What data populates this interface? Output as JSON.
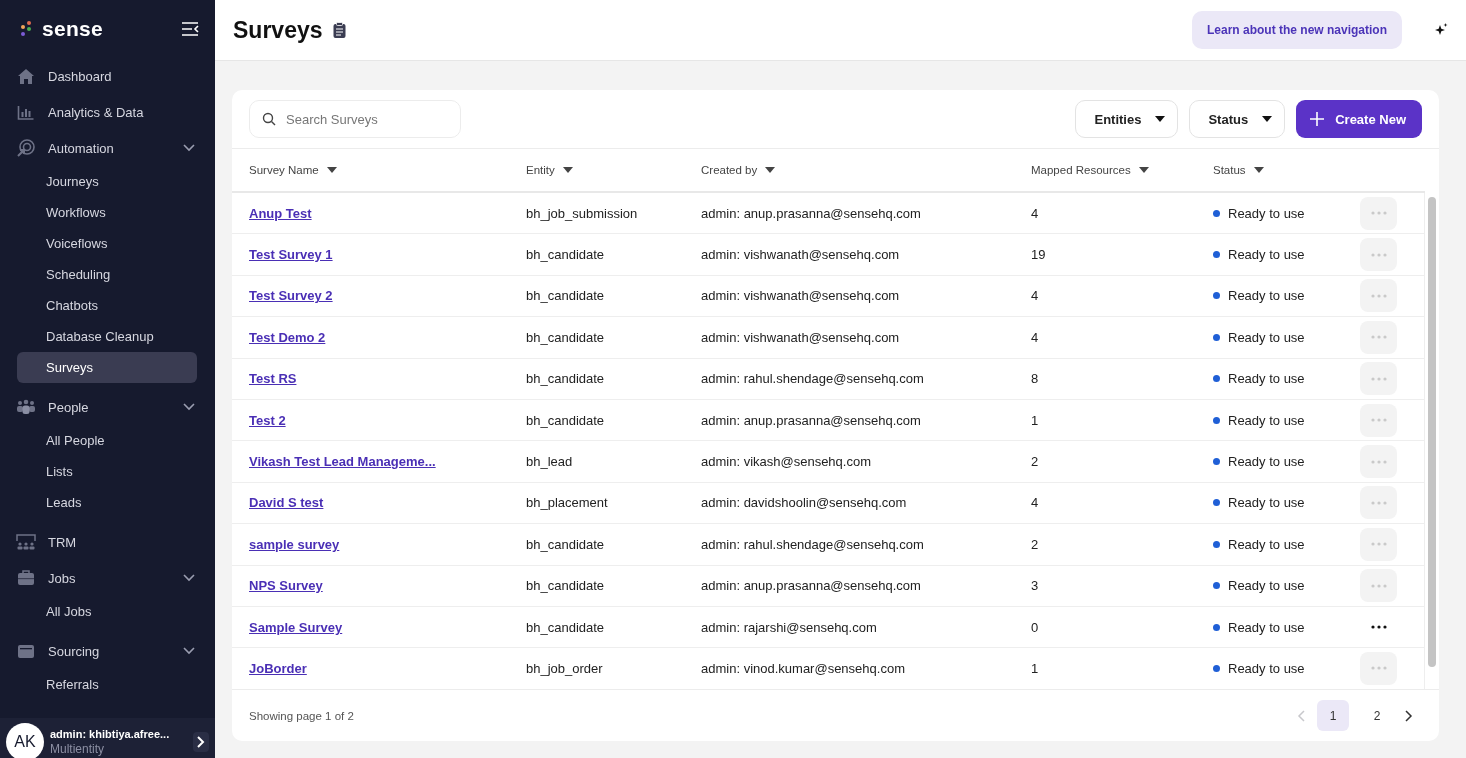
{
  "sidebar": {
    "logo": "sense",
    "nav": [
      {
        "label": "Dashboard"
      },
      {
        "label": "Analytics & Data"
      },
      {
        "label": "Automation",
        "expanded": true,
        "children": [
          {
            "label": "Journeys",
            "selected": false
          },
          {
            "label": "Workflows",
            "selected": false
          },
          {
            "label": "Voiceflows",
            "selected": false
          },
          {
            "label": "Scheduling",
            "selected": false
          },
          {
            "label": "Chatbots",
            "selected": false
          },
          {
            "label": "Database Cleanup",
            "selected": false
          },
          {
            "label": "Surveys",
            "selected": true
          }
        ]
      },
      {
        "label": "People",
        "expanded": true,
        "children": [
          {
            "label": "All People",
            "selected": false
          },
          {
            "label": "Lists",
            "selected": false
          },
          {
            "label": "Leads",
            "selected": false
          }
        ]
      },
      {
        "label": "TRM"
      },
      {
        "label": "Jobs",
        "expanded": true,
        "children": [
          {
            "label": "All Jobs",
            "selected": false
          }
        ]
      },
      {
        "label": "Sourcing",
        "expanded": true,
        "children": [
          {
            "label": "Referrals",
            "selected": false
          }
        ]
      }
    ],
    "user": {
      "initials": "AK",
      "name": "admin: khibtiya.afree...",
      "subtitle": "Multientity"
    }
  },
  "header": {
    "title": "Surveys",
    "help_button": "Learn about the new navigation"
  },
  "toolbar": {
    "search": {
      "placeholder": "Search Surveys"
    },
    "filters": [
      "Entities",
      "Status"
    ],
    "create_button": "Create New"
  },
  "table": {
    "columns": [
      "Survey Name",
      "Entity",
      "Created by",
      "Mapped Resources",
      "Status"
    ],
    "rows": [
      {
        "name": "Anup Test",
        "entity": "bh_job_submission",
        "created_by": "admin: anup.prasanna@sensehq.com",
        "mapped": "4",
        "status": "Ready to use",
        "hovered": false
      },
      {
        "name": "Test Survey 1",
        "entity": "bh_candidate",
        "created_by": "admin: vishwanath@sensehq.com",
        "mapped": "19",
        "status": "Ready to use",
        "hovered": false
      },
      {
        "name": "Test Survey 2",
        "entity": "bh_candidate",
        "created_by": "admin: vishwanath@sensehq.com",
        "mapped": "4",
        "status": "Ready to use",
        "hovered": false
      },
      {
        "name": "Test Demo 2",
        "entity": "bh_candidate",
        "created_by": "admin: vishwanath@sensehq.com",
        "mapped": "4",
        "status": "Ready to use",
        "hovered": false
      },
      {
        "name": "Test RS",
        "entity": "bh_candidate",
        "created_by": "admin: rahul.shendage@sensehq.com",
        "mapped": "8",
        "status": "Ready to use",
        "hovered": false
      },
      {
        "name": "Test 2",
        "entity": "bh_candidate",
        "created_by": "admin: anup.prasanna@sensehq.com",
        "mapped": "1",
        "status": "Ready to use",
        "hovered": false
      },
      {
        "name": "Vikash Test Lead Manageme...",
        "entity": "bh_lead",
        "created_by": "admin: vikash@sensehq.com",
        "mapped": "2",
        "status": "Ready to use",
        "hovered": false
      },
      {
        "name": "David S test",
        "entity": "bh_placement",
        "created_by": "admin: davidshoolin@sensehq.com",
        "mapped": "4",
        "status": "Ready to use",
        "hovered": false
      },
      {
        "name": "sample survey",
        "entity": "bh_candidate",
        "created_by": "admin: rahul.shendage@sensehq.com",
        "mapped": "2",
        "status": "Ready to use",
        "hovered": false
      },
      {
        "name": "NPS Survey",
        "entity": "bh_candidate",
        "created_by": "admin: anup.prasanna@sensehq.com",
        "mapped": "3",
        "status": "Ready to use",
        "hovered": false
      },
      {
        "name": "Sample Survey",
        "entity": "bh_candidate",
        "created_by": "admin: rajarshi@sensehq.com",
        "mapped": "0",
        "status": "Ready to use",
        "hovered": true
      },
      {
        "name": "JoBorder",
        "entity": "bh_job_order",
        "created_by": "admin: vinod.kumar@sensehq.com",
        "mapped": "1",
        "status": "Ready to use",
        "hovered": false
      }
    ]
  },
  "footer": {
    "summary": "Showing page 1 of 2",
    "prev_disabled": true,
    "next_disabled": false,
    "pages": [
      {
        "label": "1",
        "selected": true
      },
      {
        "label": "2",
        "selected": false
      }
    ]
  }
}
